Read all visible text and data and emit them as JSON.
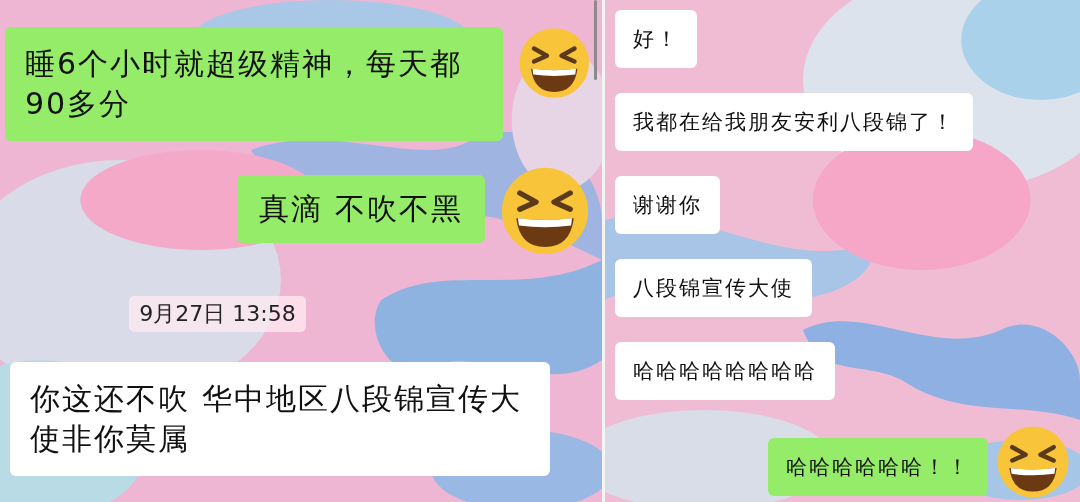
{
  "panels": [
    {
      "messages": [
        {
          "kind": "sent",
          "text": "睡6个小时就超级精神，每天都90多分"
        },
        {
          "kind": "sent",
          "text": "真滴 不吹不黑"
        },
        {
          "kind": "time",
          "text": "9月27日 13:58"
        },
        {
          "kind": "received",
          "text": "你这还不吹 华中地区八段锦宣传大使非你莫属"
        }
      ]
    },
    {
      "messages": [
        {
          "kind": "received",
          "text": "好！"
        },
        {
          "kind": "received",
          "text": "我都在给我朋友安利八段锦了！"
        },
        {
          "kind": "received",
          "text": "谢谢你"
        },
        {
          "kind": "received",
          "text": "八段锦宣传大使"
        },
        {
          "kind": "received",
          "text": "哈哈哈哈哈哈哈哈"
        },
        {
          "kind": "sent",
          "text": "哈哈哈哈哈哈！！"
        }
      ]
    }
  ]
}
